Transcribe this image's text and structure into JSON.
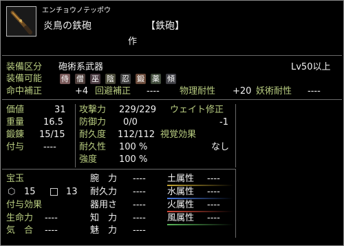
{
  "item": {
    "furigana": "エンチョウノテッポウ",
    "name": "炎鳥の鉄砲",
    "category_bracket": "【鉄砲】",
    "maker_label": "作"
  },
  "equip": {
    "class_label": "装備区分",
    "class_value": "砲術系武器",
    "level": "Lv50以上",
    "usable_label": "装備可能",
    "classes": [
      {
        "label": "侍",
        "color": "#7a5a5a"
      },
      {
        "label": "僧",
        "color": "#4e3e3a"
      },
      {
        "label": "巫",
        "color": "#4a3a40"
      },
      {
        "label": "陰",
        "color": "#4b4b3a"
      },
      {
        "label": "忍",
        "color": "#3e3e3e"
      },
      {
        "label": "鍛",
        "color": "#6a4a3a"
      },
      {
        "label": "薬",
        "color": "#3f4a3a"
      },
      {
        "label": "傾",
        "color": "#3e3e44"
      }
    ]
  },
  "mods": [
    {
      "label": "命中補正",
      "value": "+4"
    },
    {
      "label": "回避補正",
      "value": "----"
    },
    {
      "label": "物理耐性",
      "value": "+20"
    },
    {
      "label": "妖術耐性",
      "value": "----"
    }
  ],
  "stats_left": [
    {
      "label": "価値",
      "value": "31"
    },
    {
      "label": "重量",
      "value": "16.5"
    },
    {
      "label": "鍛錬",
      "value": "15/15"
    },
    {
      "label": "付与",
      "value": "----"
    }
  ],
  "stats_mid": [
    {
      "label": "攻撃力",
      "value": "229/229"
    },
    {
      "label": "防御力",
      "value": "0/0"
    },
    {
      "label": "耐久度",
      "value": "112/112"
    },
    {
      "label": "耐久性",
      "value": "100 %"
    },
    {
      "label": "強度",
      "value": "100 %"
    }
  ],
  "stats_right": {
    "weight_label": "ウェイト修正",
    "weight_value": "-1",
    "visual_label": "視覚効果",
    "visual_value": "なし"
  },
  "bottom": {
    "gem_label": "宝玉",
    "gem_a_value": "15",
    "gem_b_value": "13",
    "enchant_label": "付与効果",
    "life_label": "生命力",
    "life_value": "----",
    "ki_label": "気　合",
    "ki_value": "----"
  },
  "attrs_mid": [
    {
      "label": "腕　力",
      "value": "----"
    },
    {
      "label": "耐久力",
      "value": "----"
    },
    {
      "label": "器用さ",
      "value": "----"
    },
    {
      "label": "知　力",
      "value": "----"
    },
    {
      "label": "魅　力",
      "value": "----"
    }
  ],
  "elements": [
    {
      "label": "土属性",
      "value": "----",
      "color": "#c8a832"
    },
    {
      "label": "水属性",
      "value": "----",
      "color": "#4a7ae0"
    },
    {
      "label": "火属性",
      "value": "----",
      "color": "#d84a3a"
    },
    {
      "label": "風属性",
      "value": "----",
      "color": "#5ab85a"
    }
  ]
}
